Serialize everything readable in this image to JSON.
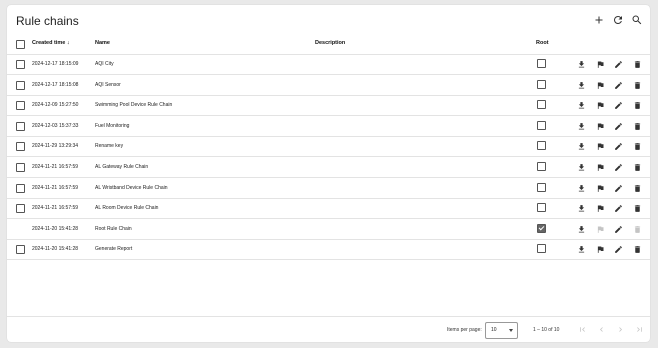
{
  "page": {
    "title": "Rule chains"
  },
  "toolbar": {
    "add_icon": "plus-icon",
    "refresh_icon": "refresh-icon",
    "search_icon": "search-icon"
  },
  "table": {
    "headers": {
      "created": "Created time",
      "sort_indicator": "↓",
      "name": "Name",
      "description": "Description",
      "root": "Root"
    },
    "rows": [
      {
        "created": "2024-12-17 18:15:09",
        "name": "AQI City",
        "description": "",
        "root": false,
        "selectable": true,
        "deletable": true
      },
      {
        "created": "2024-12-17 18:15:08",
        "name": "AQI Sensor",
        "description": "",
        "root": false,
        "selectable": true,
        "deletable": true
      },
      {
        "created": "2024-12-09 15:27:50",
        "name": "Swimming Pool Device Rule Chain",
        "description": "",
        "root": false,
        "selectable": true,
        "deletable": true
      },
      {
        "created": "2024-12-03 15:37:33",
        "name": "Fuel Monitoring",
        "description": "",
        "root": false,
        "selectable": true,
        "deletable": true
      },
      {
        "created": "2024-11-29 13:29:34",
        "name": "Rename key",
        "description": "",
        "root": false,
        "selectable": true,
        "deletable": true
      },
      {
        "created": "2024-11-21 16:57:59",
        "name": "AL Gateway Rule Chain",
        "description": "",
        "root": false,
        "selectable": true,
        "deletable": true
      },
      {
        "created": "2024-11-21 16:57:59",
        "name": "AL Wristband Device Rule Chain",
        "description": "",
        "root": false,
        "selectable": true,
        "deletable": true
      },
      {
        "created": "2024-11-21 16:57:59",
        "name": "AL Room Device Rule Chain",
        "description": "",
        "root": false,
        "selectable": true,
        "deletable": true
      },
      {
        "created": "2024-11-20 15:41:28",
        "name": "Root Rule Chain",
        "description": "",
        "root": true,
        "selectable": false,
        "deletable": false
      },
      {
        "created": "2024-11-20 15:41:28",
        "name": "Generate Report",
        "description": "",
        "root": false,
        "selectable": true,
        "deletable": true
      }
    ],
    "row_actions": [
      "export-icon",
      "flag-icon",
      "edit-icon",
      "delete-icon"
    ]
  },
  "pagination": {
    "items_per_page_label": "Items per page:",
    "page_size": "10",
    "range_label": "1 – 10 of 10",
    "icons": [
      "first-page-icon",
      "prev-page-icon",
      "next-page-icon",
      "last-page-icon"
    ]
  }
}
